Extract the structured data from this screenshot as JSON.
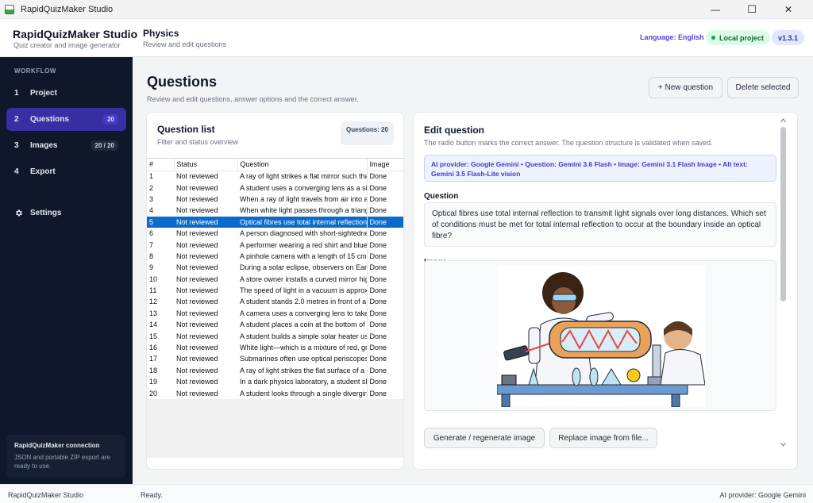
{
  "window": {
    "title": "RapidQuizMaker Studio",
    "minimize": "—",
    "maximize": "☐",
    "close": "✕"
  },
  "header": {
    "brand_title": "RapidQuizMaker Studio",
    "brand_sub": "Quiz creator and image generator",
    "project_title": "Physics",
    "project_sub": "Review and edit questions",
    "language": "Language: English",
    "local": "Local project",
    "version": "v1.3.1"
  },
  "sidebar": {
    "section": "WORKFLOW",
    "items": [
      {
        "num": "1",
        "label": "Project",
        "badge": ""
      },
      {
        "num": "2",
        "label": "Questions",
        "badge": "20"
      },
      {
        "num": "3",
        "label": "Images",
        "badge": "20 / 20"
      },
      {
        "num": "4",
        "label": "Export",
        "badge": ""
      }
    ],
    "settings": "Settings",
    "connection_title": "RapidQuizMaker connection",
    "connection_text": "JSON and portable ZIP export are ready to use."
  },
  "main": {
    "title": "Questions",
    "subtitle": "Review and edit questions, answer options and the correct answer.",
    "new_button": "+ New question",
    "delete_button": "Delete selected"
  },
  "question_list": {
    "title": "Question list",
    "subtitle": "Filter and status overview",
    "count": "Questions: 20",
    "columns": [
      "#",
      "Status",
      "Question",
      "Image"
    ],
    "selected_index": 4,
    "rows": [
      [
        "1",
        "Not reviewed",
        "A ray of light strikes a flat mirror such that",
        "Done"
      ],
      [
        "2",
        "Not reviewed",
        "A student uses a converging lens as a sim",
        "Done"
      ],
      [
        "3",
        "Not reviewed",
        "When a ray of light travels from air into a",
        "Done"
      ],
      [
        "4",
        "Not reviewed",
        "When white light passes through a triangu",
        "Done"
      ],
      [
        "5",
        "Not reviewed",
        "Optical fibres use total internal reflection",
        "Done"
      ],
      [
        "6",
        "Not reviewed",
        "A person diagnosed with short-sightedne",
        "Done"
      ],
      [
        "7",
        "Not reviewed",
        "A performer wearing a red shirt and blue",
        "Done"
      ],
      [
        "8",
        "Not reviewed",
        "A pinhole camera with a length of 15 cm",
        "Done"
      ],
      [
        "9",
        "Not reviewed",
        "During a solar eclipse, observers on Earth",
        "Done"
      ],
      [
        "10",
        "Not reviewed",
        "A store owner installs a curved mirror hig",
        "Done"
      ],
      [
        "11",
        "Not reviewed",
        "The speed of light in a vacuum is approxi",
        "Done"
      ],
      [
        "12",
        "Not reviewed",
        "A student stands 2.0 metres in front of a",
        "Done"
      ],
      [
        "13",
        "Not reviewed",
        "A camera uses a converging lens to take",
        "Done"
      ],
      [
        "14",
        "Not reviewed",
        "A student places a coin at the bottom of",
        "Done"
      ],
      [
        "15",
        "Not reviewed",
        "A student builds a simple solar heater us",
        "Done"
      ],
      [
        "16",
        "Not reviewed",
        "White light—which is a mixture of red, gr",
        "Done"
      ],
      [
        "17",
        "Not reviewed",
        "Submarines often use optical periscopes",
        "Done"
      ],
      [
        "18",
        "Not reviewed",
        "A ray of light strikes the flat surface of a",
        "Done"
      ],
      [
        "19",
        "Not reviewed",
        "In a dark physics laboratory, a student sh",
        "Done"
      ],
      [
        "20",
        "Not reviewed",
        "A student looks through a single divergin",
        "Done"
      ]
    ]
  },
  "editor": {
    "title": "Edit question",
    "subtitle": "The radio button marks the correct answer. The question structure is validated when saved.",
    "ai_info": "AI provider: Google Gemini • Question: Gemini 3.6 Flash • Image: Gemini 3.1 Flash Image • Alt text: Gemini 3.5 Flash-Lite vision",
    "question_label": "Question",
    "question_text": "Optical fibres use total internal reflection to transmit light signals over long distances. Which set of conditions must be met for total internal reflection to occur at the boundary inside an optical fibre?",
    "image_label": "Image",
    "generate_button": "Generate / regenerate image",
    "replace_button": "Replace image from file..."
  },
  "status_bar": {
    "app": "RapidQuizMaker Studio",
    "state": "Ready.",
    "provider": "AI provider: Google Gemini"
  },
  "colors": {
    "accent": "#3730a3",
    "selection": "#0b6bcb",
    "sidebar": "#0f172a",
    "success": "#16a34a"
  }
}
